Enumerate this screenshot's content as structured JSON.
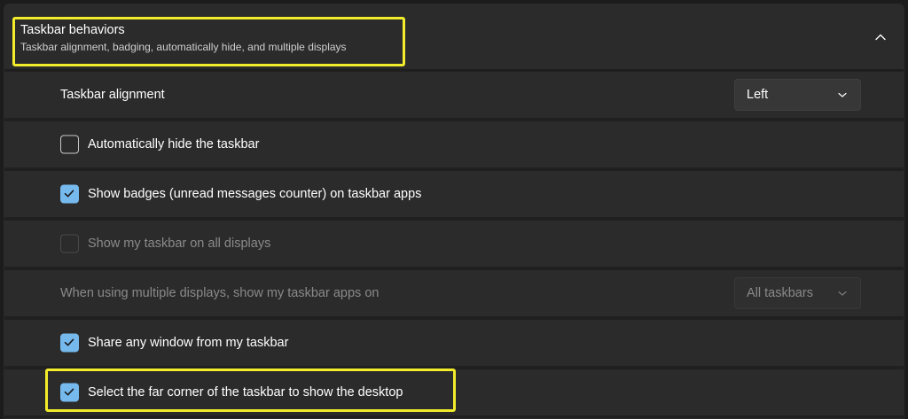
{
  "section": {
    "title": "Taskbar behaviors",
    "subtitle": "Taskbar alignment, badging, automatically hide, and multiple displays",
    "expanded": true
  },
  "settings": [
    {
      "type": "dropdown",
      "label": "Taskbar alignment",
      "value": "Left",
      "enabled": true
    },
    {
      "type": "checkbox",
      "label": "Automatically hide the taskbar",
      "checked": false,
      "enabled": true
    },
    {
      "type": "checkbox",
      "label": "Show badges (unread messages counter) on taskbar apps",
      "checked": true,
      "enabled": true
    },
    {
      "type": "checkbox",
      "label": "Show my taskbar on all displays",
      "checked": false,
      "enabled": false
    },
    {
      "type": "dropdown",
      "label": "When using multiple displays, show my taskbar apps on",
      "value": "All taskbars",
      "enabled": false
    },
    {
      "type": "checkbox",
      "label": "Share any window from my taskbar",
      "checked": true,
      "enabled": true
    },
    {
      "type": "checkbox",
      "label": "Select the far corner of the taskbar to show the desktop",
      "checked": true,
      "enabled": true
    }
  ],
  "colors": {
    "accent": "#76b9ed",
    "highlight": "#f2ec2b",
    "background": "#202020",
    "row": "#2b2b2b"
  },
  "icons": {
    "collapse": "chevron-up-icon",
    "dropdown": "chevron-down-icon",
    "check": "checkmark-icon"
  }
}
